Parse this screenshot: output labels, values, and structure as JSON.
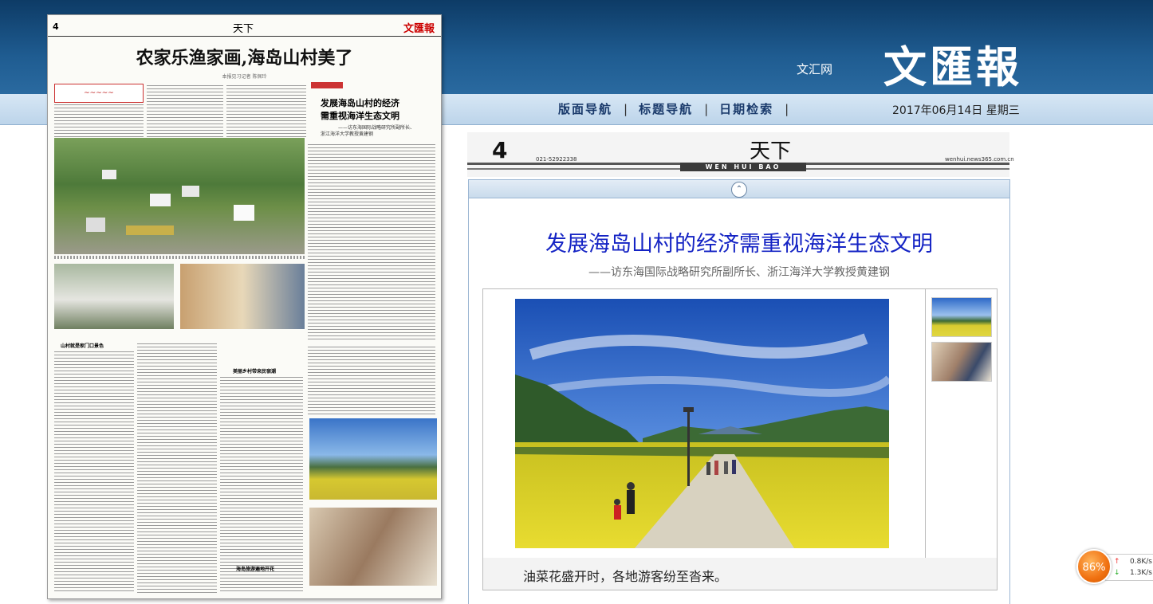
{
  "header": {
    "site_name": "文汇网",
    "masthead": "文匯報",
    "nav": {
      "layout_nav": "版面导航",
      "title_nav": "标题导航",
      "date_search": "日期检索",
      "separator": "|"
    },
    "date": "2017年06月14日 星期三"
  },
  "page_thumbnail": {
    "page_no": "4",
    "section": "天下",
    "masthead": "文匯報",
    "headline": "农家乐渔家画,海岛山村美了",
    "byline": "本报见习记者 陈佩玲",
    "interview_title_line1": "发展海岛山村的经济",
    "interview_title_line2": "需重视海洋生态文明",
    "interview_sub_line1": "——访东海国际战略研究所副所长、",
    "interview_sub_line2": "浙江海洋大学教授黄建钢",
    "section_heading_1": "山村就是家门口景色",
    "section_heading_2": "美丽乡村带来民宿潮",
    "section_heading_3": "海岛旅游遍地开花"
  },
  "page_header": {
    "page_number": "4",
    "page_name": "天下",
    "phone": "021-52922338",
    "paper_band": "WEN HUI BAO",
    "url": "wenhui.news365.com.cn"
  },
  "article": {
    "collapse_icon": "chevron-up-icon",
    "headline": "发展海岛山村的经济需重视海洋生态文明",
    "subheadline": "——访东海国际战略研究所副所长、浙江海洋大学教授黄建钢",
    "photo_caption": "油菜花盛开时，各地游客纷至沓来。"
  },
  "speed_widget": {
    "percent": "86%",
    "upload": "0.8K/s",
    "download": "1.3K/s"
  },
  "colors": {
    "header_blue": "#1f5c91",
    "headline_blue": "#1423c4",
    "widget_orange": "#f07010"
  }
}
